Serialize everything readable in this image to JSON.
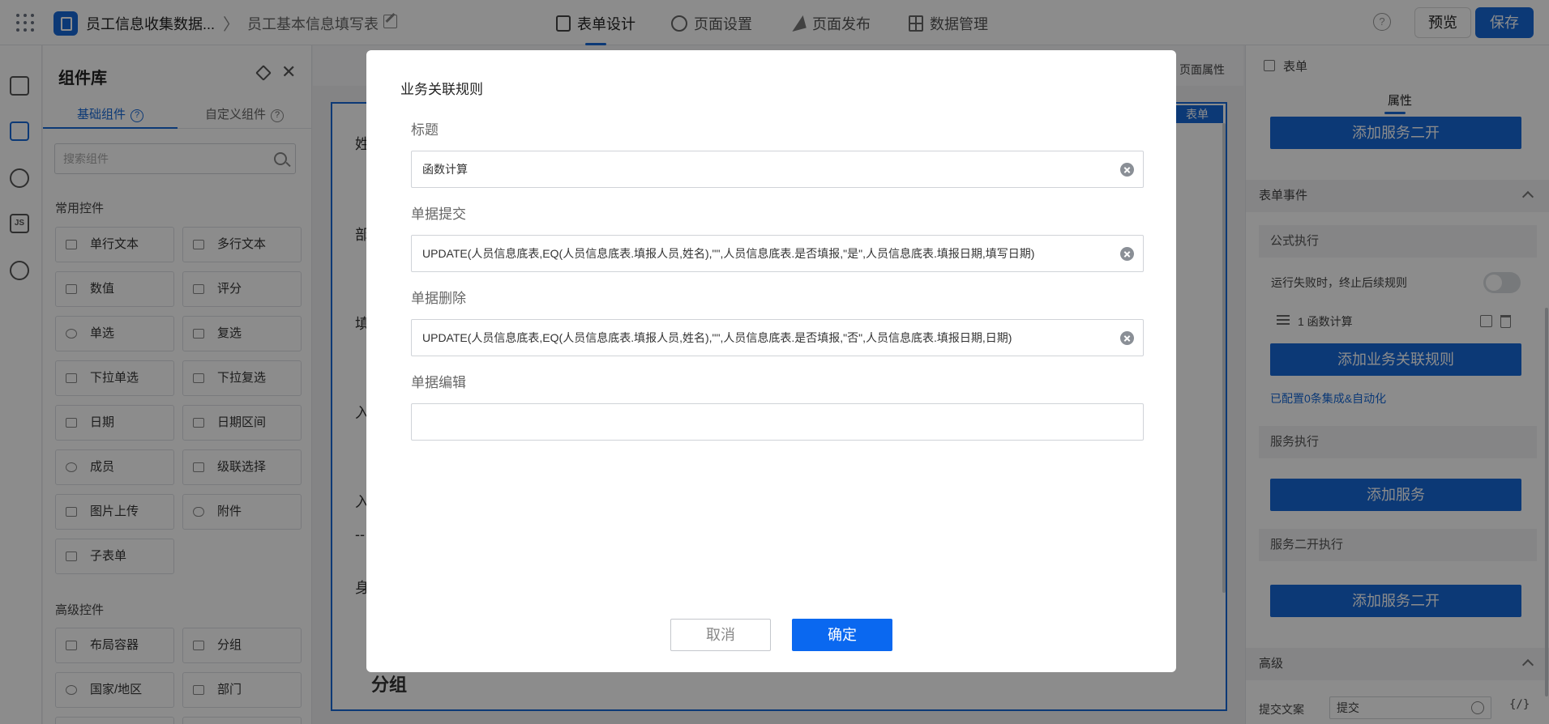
{
  "topbar": {
    "app_name": "员工信息收集数据...",
    "crumb_sep": "〉",
    "form_name": "员工基本信息填写表",
    "tabs": [
      {
        "label": "表单设计",
        "icon": "document-icon"
      },
      {
        "label": "页面设置",
        "icon": "gear-icon"
      },
      {
        "label": "页面发布",
        "icon": "send-icon"
      },
      {
        "label": "数据管理",
        "icon": "table-icon"
      }
    ],
    "help": "?",
    "preview_label": "预览",
    "save_label": "保存"
  },
  "rail": {
    "js_label": "JS"
  },
  "library": {
    "title": "组件库",
    "close": "✕",
    "tabs": [
      "基础组件",
      "自定义组件"
    ],
    "tab_help": "?",
    "search_placeholder": "搜索组件",
    "section_common": "常用控件",
    "common": [
      "单行文本",
      "多行文本",
      "数值",
      "评分",
      "单选",
      "复选",
      "下拉单选",
      "下拉复选",
      "日期",
      "日期区间",
      "成员",
      "级联选择",
      "图片上传",
      "附件",
      "子表单"
    ],
    "section_advanced": "高级控件",
    "advanced": [
      "布局容器",
      "分组",
      "国家/地区",
      "部门"
    ]
  },
  "canvas": {
    "page_attr": "页面属性",
    "form_tag": "表单",
    "labels": [
      "姓",
      "部",
      "填",
      "入",
      "入",
      "--",
      "身"
    ],
    "group_title": "分组"
  },
  "right_panel": {
    "head": "表单",
    "attr_tab": "属性",
    "btn_service_dev_top": "添加服务二开",
    "form_events": "表单事件",
    "formula_exec": "公式执行",
    "stop_on_fail": "运行失败时，终止后续规则",
    "rule_item": "1 函数计算",
    "btn_add_rule": "添加业务关联规则",
    "configured_link": "已配置0条集成&自动化",
    "service_exec": "服务执行",
    "btn_add_service": "添加服务",
    "service_dev_exec": "服务二开执行",
    "btn_service_dev": "添加服务二开",
    "advanced": "高级",
    "submit_text_label": "提交文案",
    "submit_text_value": "提交",
    "code_icon": "{/}"
  },
  "modal": {
    "title": "业务关联规则",
    "fields": [
      {
        "label": "标题",
        "value": "函数计算"
      },
      {
        "label": "单据提交",
        "value": "UPDATE(人员信息底表,EQ(人员信息底表.填报人员,姓名),\"\",人员信息底表.是否填报,\"是\",人员信息底表.填报日期,填写日期)"
      },
      {
        "label": "单据删除",
        "value": "UPDATE(人员信息底表,EQ(人员信息底表.填报人员,姓名),\"\",人员信息底表.是否填报,\"否\",人员信息底表.填报日期,日期)"
      },
      {
        "label": "单据编辑",
        "value": ""
      }
    ],
    "cancel_label": "取消",
    "ok_label": "确定"
  },
  "colors": {
    "accent": "#1669d8",
    "primary_button": "#0a68f0"
  }
}
